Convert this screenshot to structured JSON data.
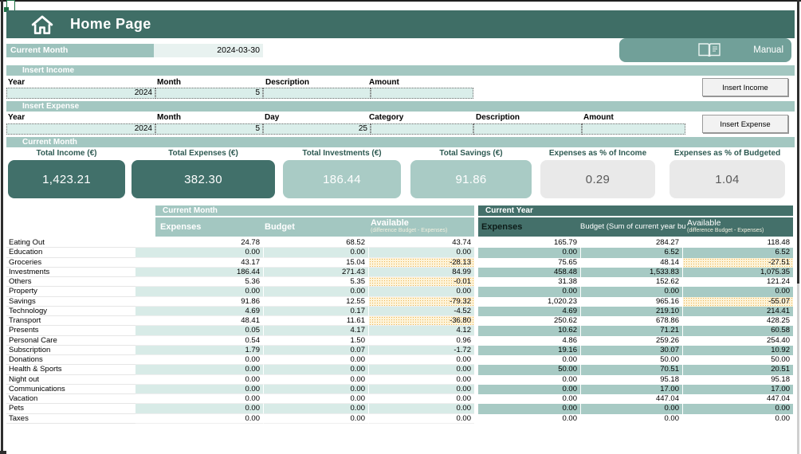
{
  "header": {
    "title": "Home Page"
  },
  "current_month_bar": {
    "label": "Current Month",
    "date": "2024-03-30"
  },
  "manual": {
    "label": "Manual"
  },
  "insert_income": {
    "title": "Insert Income",
    "labels": {
      "year": "Year",
      "month": "Month",
      "description": "Description",
      "amount": "Amount"
    },
    "values": {
      "year": "2024",
      "month": "5",
      "description": "",
      "amount": ""
    },
    "button": "Insert Income"
  },
  "insert_expense": {
    "title": "Insert Expense",
    "labels": {
      "year": "Year",
      "month": "Month",
      "day": "Day",
      "category": "Category",
      "description": "Description",
      "amount": "Amount"
    },
    "values": {
      "year": "2024",
      "month": "5",
      "day": "25",
      "category": "",
      "description": "",
      "amount": ""
    },
    "button": "Insert Expense"
  },
  "summary": {
    "title": "Current Month",
    "cards": [
      {
        "label": "Total Income (€)",
        "value": "1,423.21",
        "variant": "dark"
      },
      {
        "label": "Total Expenses (€)",
        "value": "382.30",
        "variant": "dark"
      },
      {
        "label": "Total Investments (€)",
        "value": "186.44",
        "variant": "teal"
      },
      {
        "label": "Total Savings (€)",
        "value": "91.86",
        "variant": "teal"
      },
      {
        "label": "Expenses as % of Income",
        "value": "0.29",
        "variant": "gray"
      },
      {
        "label": "Expenses as % of Budgeted",
        "value": "1.04",
        "variant": "gray"
      }
    ]
  },
  "tables": {
    "month": {
      "title": "Current Month",
      "col_expenses": "Expenses",
      "col_budget": "Budget",
      "col_available": "Available",
      "available_note": "(difference Budget - Expenses)"
    },
    "year": {
      "title": "Current Year",
      "col_expenses": "Expenses",
      "col_budget": "Budget (Sum of current year bu",
      "col_available": "Available",
      "available_note": "(difference Budget - Expenses)"
    },
    "categories": [
      "Eating Out",
      "Education",
      "Groceries",
      "Investments",
      "Others",
      "Property",
      "Savings",
      "Technology",
      "Transport",
      "Presents",
      "Personal Care",
      "Subscription",
      "Donations",
      "Health & Sports",
      "Night out",
      "Communications",
      "Vacation",
      "Pets",
      "Taxes"
    ],
    "month_rows": [
      [
        "24.78",
        "68.52",
        "43.74"
      ],
      [
        "0.00",
        "0.00",
        "0.00"
      ],
      [
        "43.17",
        "15.04",
        "-28.13"
      ],
      [
        "186.44",
        "271.43",
        "84.99"
      ],
      [
        "5.36",
        "5.35",
        "-0.01"
      ],
      [
        "0.00",
        "0.00",
        "0.00"
      ],
      [
        "91.86",
        "12.55",
        "-79.32"
      ],
      [
        "4.69",
        "0.17",
        "-4.52"
      ],
      [
        "48.41",
        "11.61",
        "-36.80"
      ],
      [
        "0.05",
        "4.17",
        "4.12"
      ],
      [
        "0.54",
        "1.50",
        "0.96"
      ],
      [
        "1.79",
        "0.07",
        "-1.72"
      ],
      [
        "0.00",
        "0.00",
        "0.00"
      ],
      [
        "0.00",
        "0.00",
        "0.00"
      ],
      [
        "0.00",
        "0.00",
        "0.00"
      ],
      [
        "0.00",
        "0.00",
        "0.00"
      ],
      [
        "0.00",
        "0.00",
        "0.00"
      ],
      [
        "0.00",
        "0.00",
        "0.00"
      ],
      [
        "0.00",
        "0.00",
        "0.00"
      ]
    ],
    "year_rows": [
      [
        "165.79",
        "284.27",
        "118.48"
      ],
      [
        "0.00",
        "6.52",
        "6.52"
      ],
      [
        "75.65",
        "48.14",
        "-27.51"
      ],
      [
        "458.48",
        "1,533.83",
        "1,075.35"
      ],
      [
        "31.38",
        "152.62",
        "121.24"
      ],
      [
        "0.00",
        "0.00",
        "0.00"
      ],
      [
        "1,020.23",
        "965.16",
        "-55.07"
      ],
      [
        "4.69",
        "219.10",
        "214.41"
      ],
      [
        "250.62",
        "678.86",
        "428.25"
      ],
      [
        "10.62",
        "71.21",
        "60.58"
      ],
      [
        "4.86",
        "259.26",
        "254.40"
      ],
      [
        "19.16",
        "30.07",
        "10.92"
      ],
      [
        "0.00",
        "50.00",
        "50.00"
      ],
      [
        "50.00",
        "70.51",
        "20.51"
      ],
      [
        "0.00",
        "95.18",
        "95.18"
      ],
      [
        "0.00",
        "17.00",
        "17.00"
      ],
      [
        "0.00",
        "447.04",
        "447.04"
      ],
      [
        "0.00",
        "0.00",
        "0.00"
      ],
      [
        "0.00",
        "0.00",
        "0.00"
      ]
    ]
  },
  "colors": {
    "accent_dark": "#3f6e66",
    "accent_light": "#a3c7c1",
    "stripe_month": "#d8ebe7",
    "stripe_year": "#a7cac4",
    "negative_bg": "#fdf3d8"
  }
}
